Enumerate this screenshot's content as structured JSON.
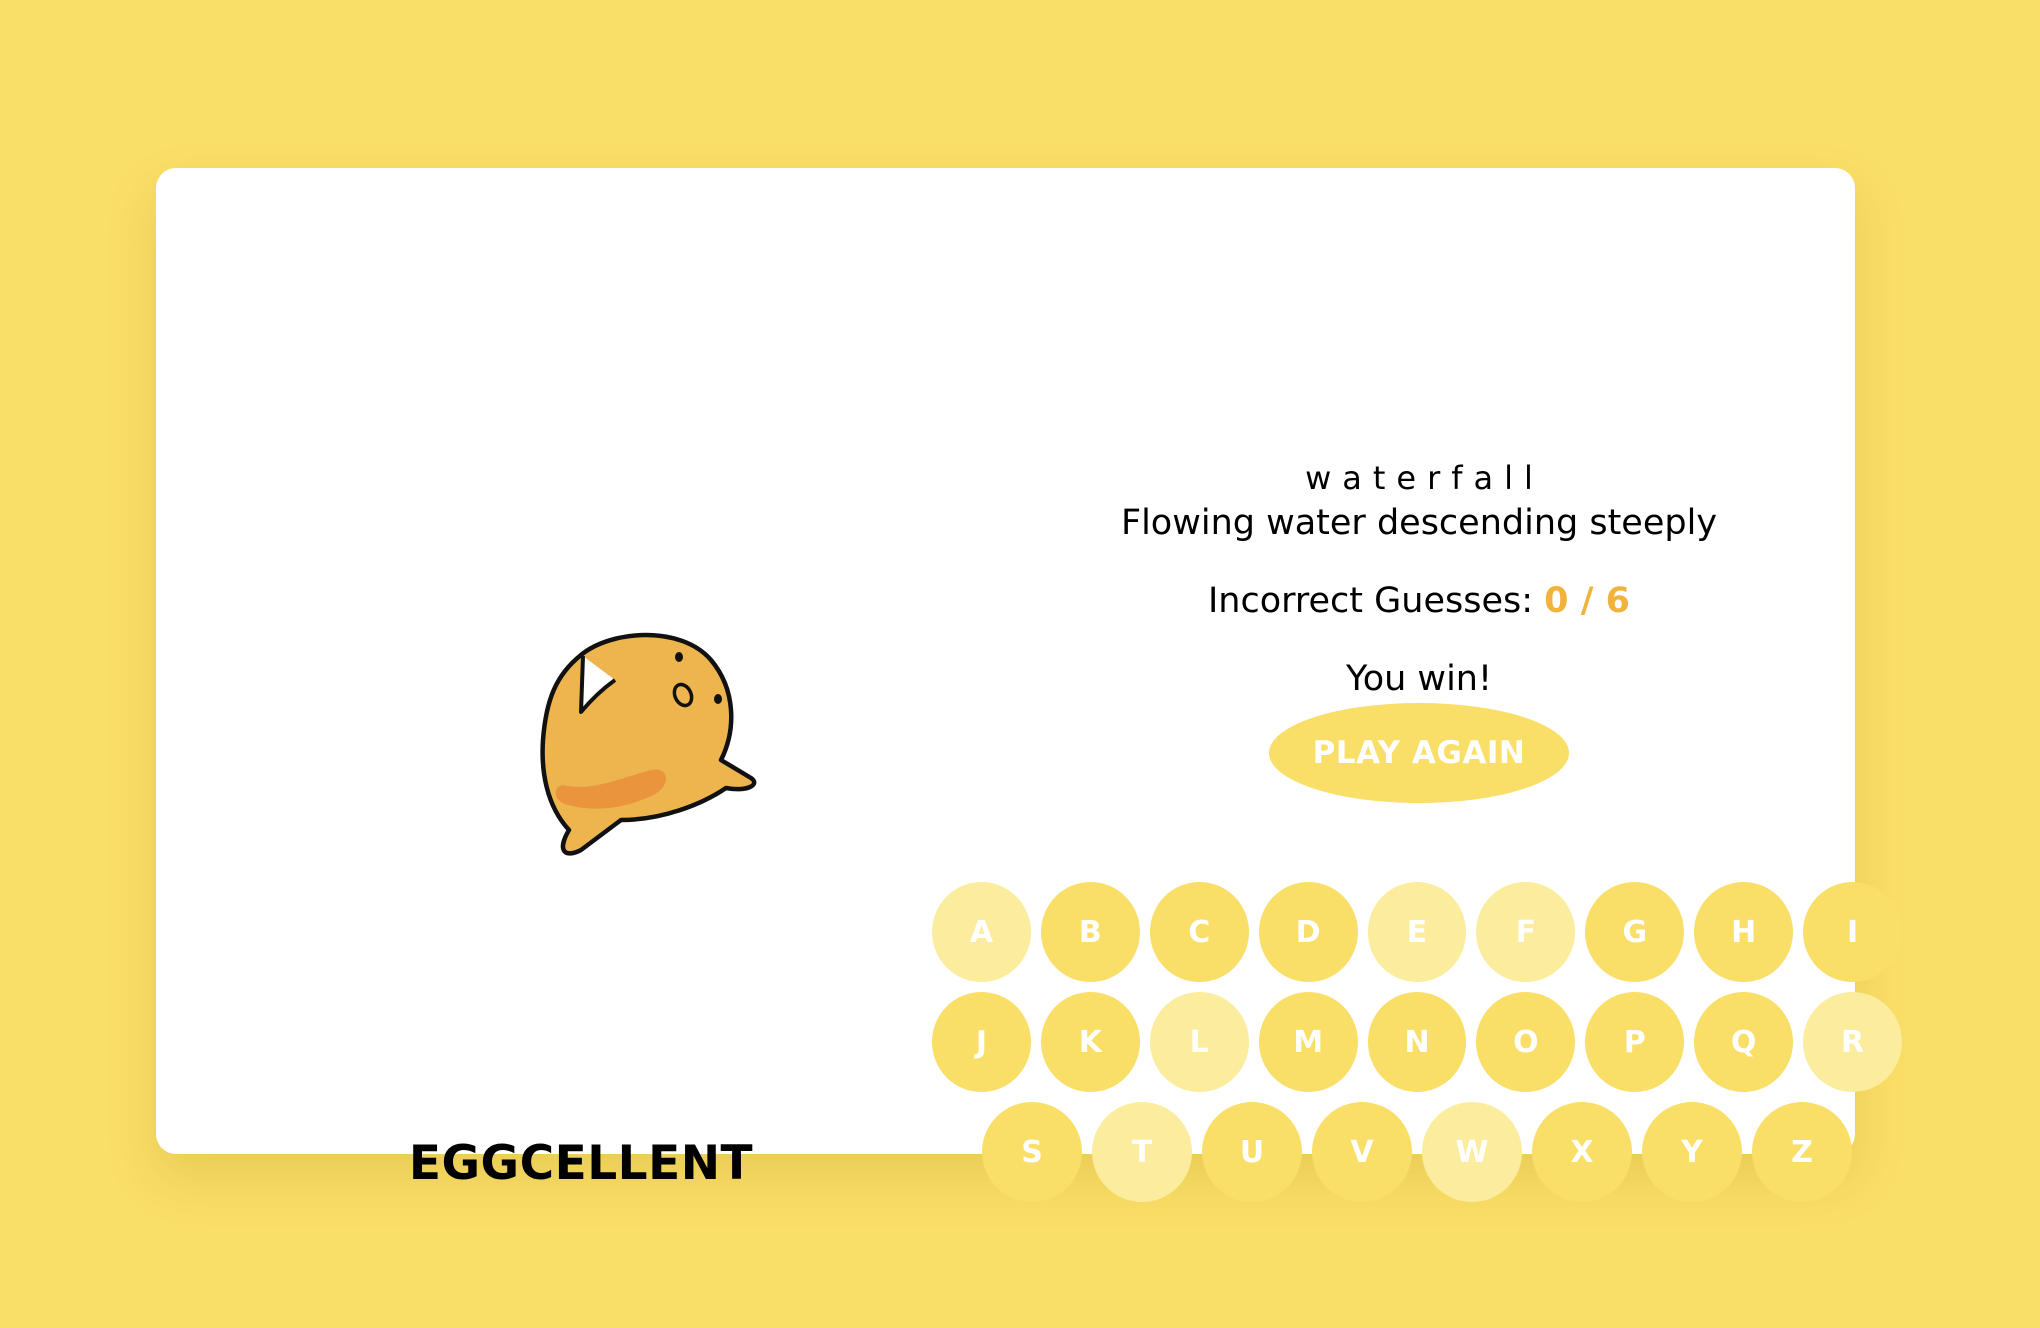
{
  "colors": {
    "background": "#f9de67",
    "card": "#ffffff",
    "key_active": "#f9de67",
    "key_used": "#fcec9d",
    "count_accent": "#f2b33d"
  },
  "mascot": {
    "icon": "egg-yolk-mascot-icon"
  },
  "tagline": "EGGCELLENT",
  "game": {
    "word": "waterfall",
    "hint": "Flowing water descending steeply",
    "incorrect_label": "Incorrect Guesses:",
    "incorrect_count": "0 / 6",
    "result": "You win!",
    "play_again_label": "PLAY AGAIN"
  },
  "keyboard": {
    "rows": [
      [
        {
          "letter": "A",
          "used": true
        },
        {
          "letter": "B",
          "used": false
        },
        {
          "letter": "C",
          "used": false
        },
        {
          "letter": "D",
          "used": false
        },
        {
          "letter": "E",
          "used": true
        },
        {
          "letter": "F",
          "used": true
        },
        {
          "letter": "G",
          "used": false
        },
        {
          "letter": "H",
          "used": false
        },
        {
          "letter": "I",
          "used": false
        }
      ],
      [
        {
          "letter": "J",
          "used": false
        },
        {
          "letter": "K",
          "used": false
        },
        {
          "letter": "L",
          "used": true
        },
        {
          "letter": "M",
          "used": false
        },
        {
          "letter": "N",
          "used": false
        },
        {
          "letter": "O",
          "used": false
        },
        {
          "letter": "P",
          "used": false
        },
        {
          "letter": "Q",
          "used": false
        },
        {
          "letter": "R",
          "used": true
        }
      ],
      [
        {
          "letter": "S",
          "used": false
        },
        {
          "letter": "T",
          "used": true
        },
        {
          "letter": "U",
          "used": false
        },
        {
          "letter": "V",
          "used": false
        },
        {
          "letter": "W",
          "used": true
        },
        {
          "letter": "X",
          "used": false
        },
        {
          "letter": "Y",
          "used": false
        },
        {
          "letter": "Z",
          "used": false
        }
      ]
    ]
  }
}
